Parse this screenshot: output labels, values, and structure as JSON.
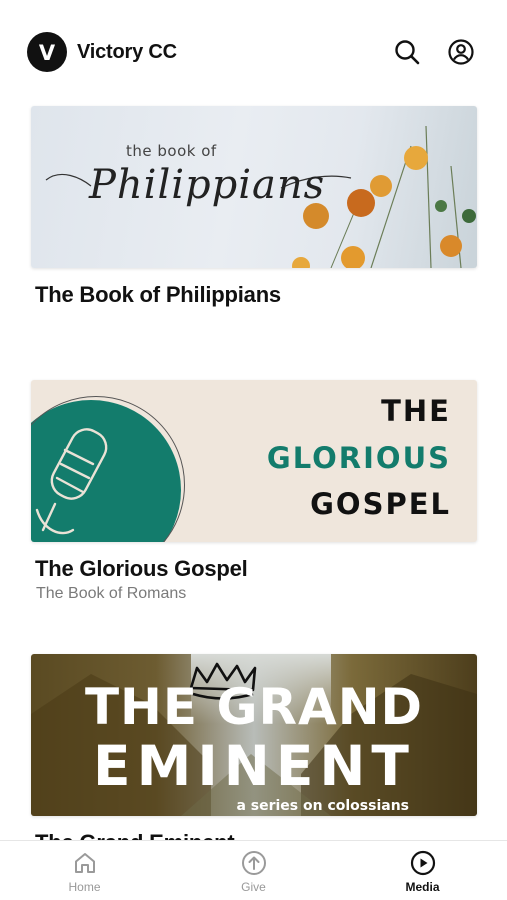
{
  "app": {
    "logo_letter": "V",
    "title": "Victory CC"
  },
  "header": {
    "icons": [
      "search-icon",
      "account-icon"
    ]
  },
  "cards": [
    {
      "title": "The Book of Philippians",
      "subtitle": "",
      "banner": {
        "small_text": "the book of",
        "script_text": "Philippians"
      }
    },
    {
      "title": "The Glorious Gospel",
      "subtitle": "The Book of Romans",
      "banner": {
        "line1": "THE",
        "line2": "GLORIOUS",
        "line3": "GOSPEL"
      }
    },
    {
      "title": "The Grand Eminent",
      "subtitle": "",
      "banner": {
        "line1": "THE GRAND",
        "line2": "EMINENT",
        "tagline": "a series on colossians"
      }
    }
  ],
  "tabs": [
    {
      "label": "Home",
      "icon": "home-icon",
      "active": false
    },
    {
      "label": "Give",
      "icon": "give-icon",
      "active": false
    },
    {
      "label": "Media",
      "icon": "media-play-icon",
      "active": true
    }
  ],
  "colors": {
    "accent_teal": "#137c6c",
    "text_primary": "#111111",
    "text_secondary": "#7a7a7a",
    "tab_inactive": "#999999"
  }
}
